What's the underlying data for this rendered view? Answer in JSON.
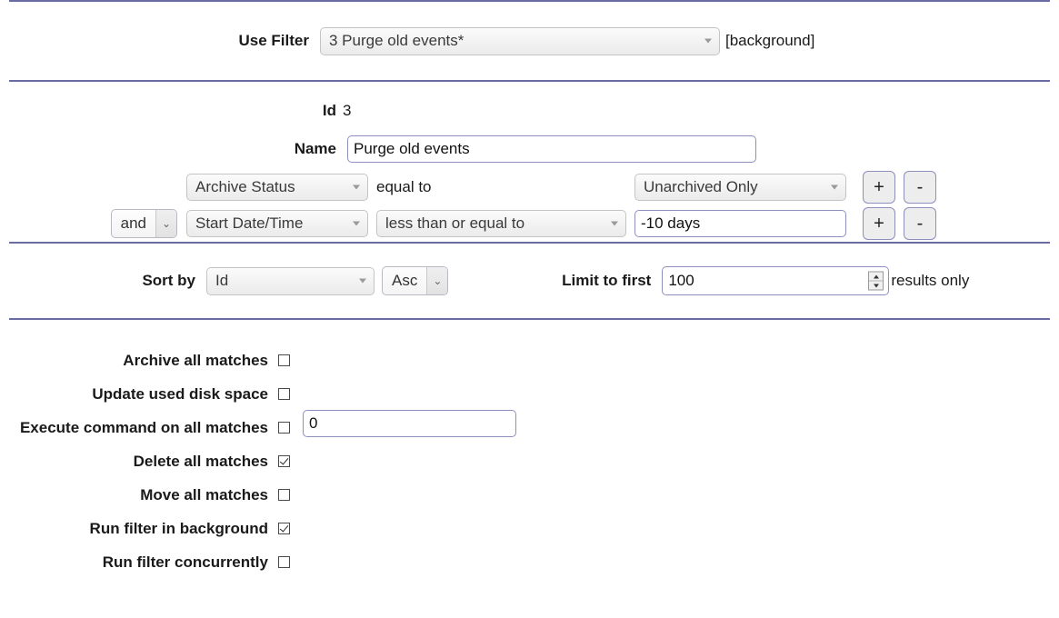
{
  "colors": {
    "divider": "#6b6ba3",
    "input_border": "#8f8fbe",
    "text": "#1a1a1a"
  },
  "use_filter": {
    "label": "Use Filter",
    "selected": "3 Purge old events*",
    "dropdown_icon": "chevron-down-icon",
    "background_tag": "[background]"
  },
  "details": {
    "id_label": "Id",
    "id_value": "3",
    "name_label": "Name",
    "name_value": "Purge old events",
    "name_placeholder": ""
  },
  "conditions": [
    {
      "conjunction": null,
      "field": "Archive Status",
      "operator_text": "equal to",
      "operator_is_dropdown": false,
      "value": "Unarchived Only",
      "value_is_dropdown": true,
      "add_label": "+",
      "remove_label": "-"
    },
    {
      "conjunction": "and",
      "field": "Start Date/Time",
      "operator_text": "less than or equal to",
      "operator_is_dropdown": true,
      "value": "-10 days",
      "value_is_dropdown": false,
      "add_label": "+",
      "remove_label": "-"
    }
  ],
  "sort": {
    "sort_by_label": "Sort by",
    "sort_by_value": "Id",
    "direction_value": "Asc",
    "limit_label": "Limit to first",
    "limit_value": "100",
    "results_suffix": "results only"
  },
  "options": [
    {
      "label": "Archive all matches",
      "checked": false
    },
    {
      "label": "Update used disk space",
      "checked": false
    },
    {
      "label": "Execute command on all matches",
      "checked": false,
      "input_value": "0"
    },
    {
      "label": "Delete all matches",
      "checked": true
    },
    {
      "label": "Move all matches",
      "checked": false
    },
    {
      "label": "Run filter in background",
      "checked": true
    },
    {
      "label": "Run filter concurrently",
      "checked": false
    }
  ]
}
